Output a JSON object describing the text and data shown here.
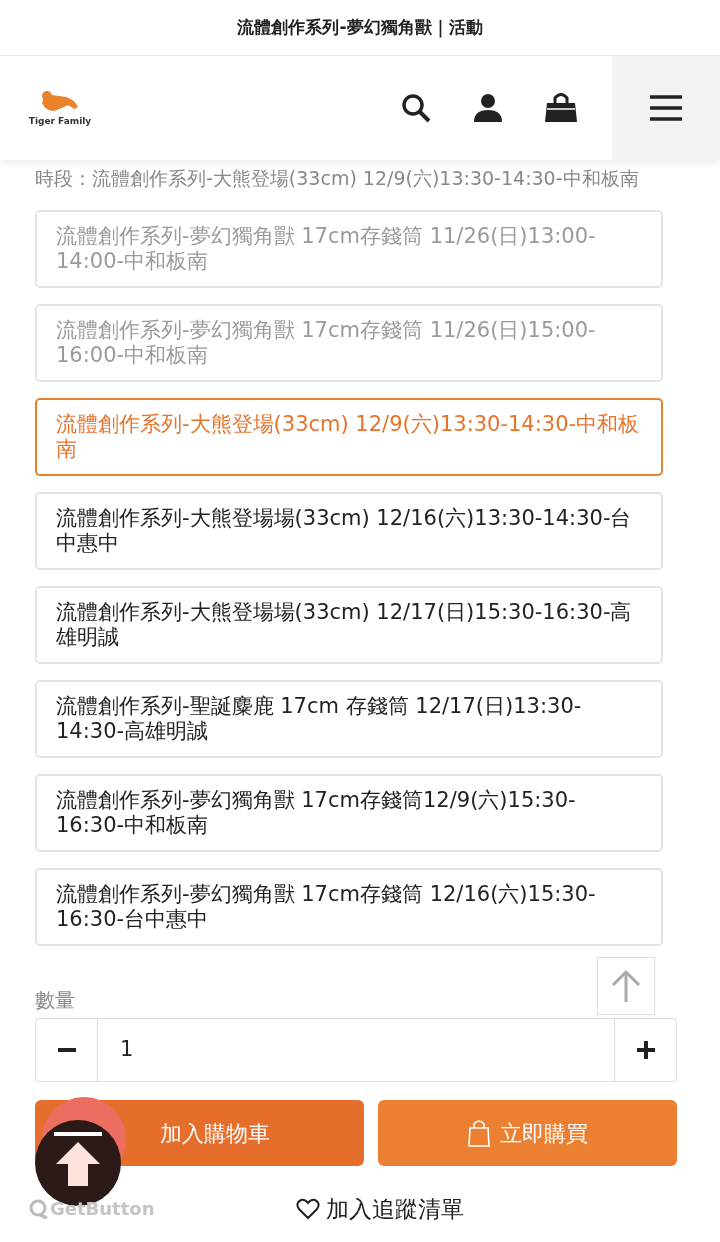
{
  "top_bar": {
    "title": "流體創作系列-夢幻獨角獸｜活動"
  },
  "header": {
    "logo_text": "Tiger Family"
  },
  "session_label": "時段：流體創作系列-大熊登場(33cm) 12/9(六)13:30-14:30-中和板南",
  "options": [
    {
      "label": "流體創作系列-夢幻獨角獸 17cm存錢筒 11/26(日)13:00-14:00-中和板南",
      "disabled": true,
      "selected": false
    },
    {
      "label": "流體創作系列-夢幻獨角獸 17cm存錢筒 11/26(日)15:00-16:00-中和板南",
      "disabled": true,
      "selected": false
    },
    {
      "label": "流體創作系列-大熊登場(33cm) 12/9(六)13:30-14:30-中和板南",
      "disabled": false,
      "selected": true
    },
    {
      "label": "流體創作系列-大熊登場場(33cm) 12/16(六)13:30-14:30-台中惠中",
      "disabled": false,
      "selected": false
    },
    {
      "label": "流體創作系列-大熊登場場(33cm) 12/17(日)15:30-16:30-高雄明誠",
      "disabled": false,
      "selected": false
    },
    {
      "label": "流體創作系列-聖誕麋鹿 17cm 存錢筒 12/17(日)13:30-14:30-高雄明誠",
      "disabled": false,
      "selected": false
    },
    {
      "label": "流體創作系列-夢幻獨角獸 17cm存錢筒12/9(六)15:30-16:30-中和板南",
      "disabled": false,
      "selected": false
    },
    {
      "label": "流體創作系列-夢幻獨角獸 17cm存錢筒 12/16(六)15:30-16:30-台中惠中",
      "disabled": false,
      "selected": false
    }
  ],
  "quantity": {
    "label": "數量",
    "value": "1"
  },
  "buttons": {
    "add_to_cart": "加入購物車",
    "buy_now": "立即購買",
    "wishlist": "加入追蹤清單"
  },
  "widget": {
    "brand": "GetButton"
  }
}
